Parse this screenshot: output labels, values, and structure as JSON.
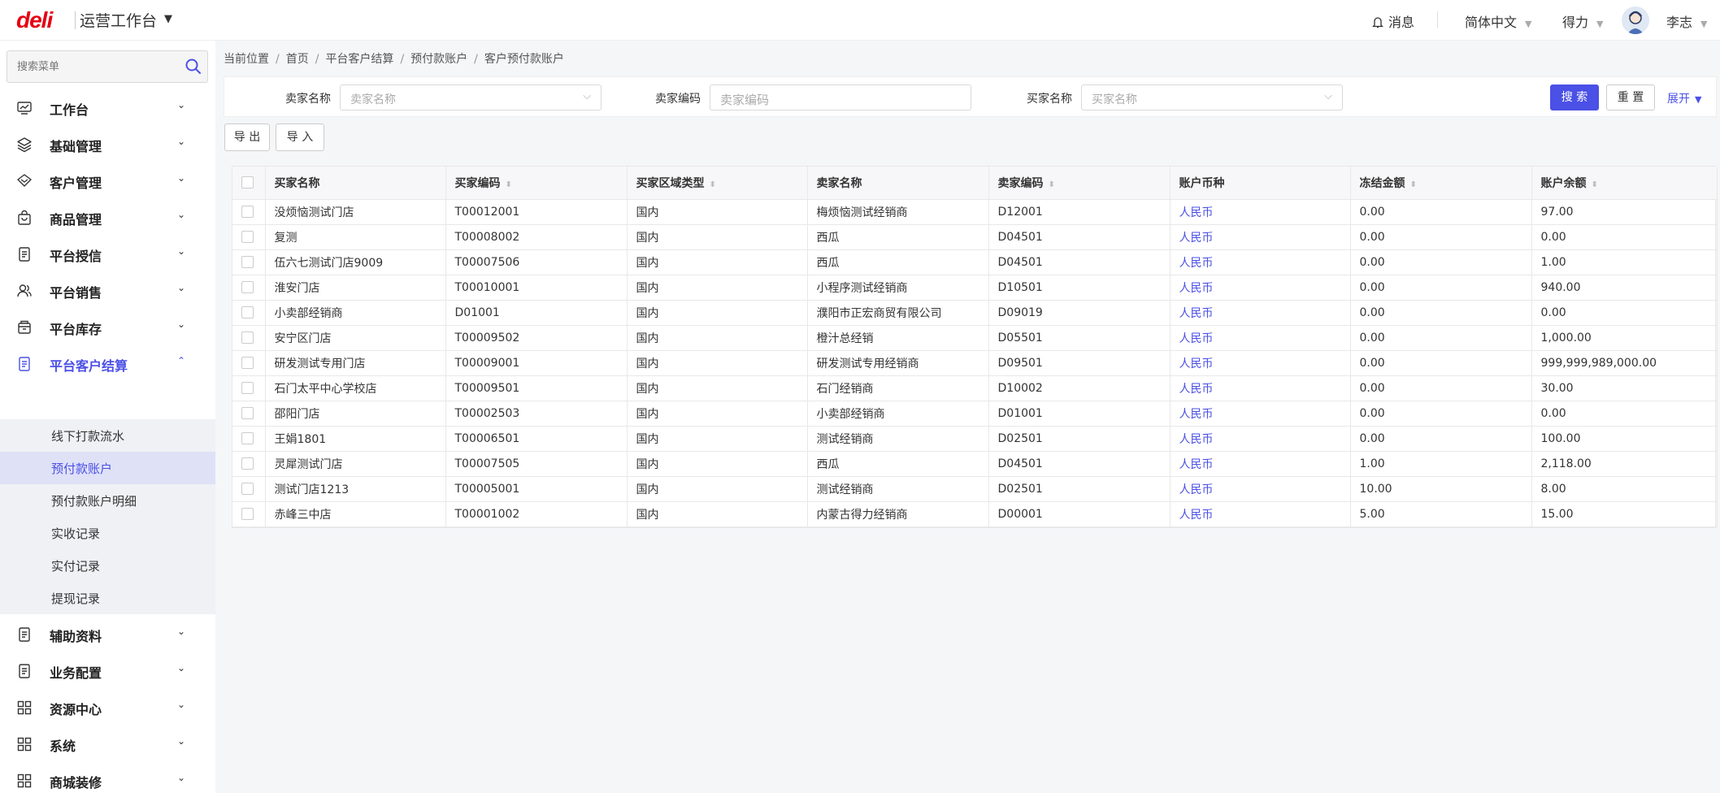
{
  "header": {
    "logo": "deli",
    "app_title": "运营工作台",
    "messages_label": "消息",
    "language": "简体中文",
    "brand": "得力",
    "user": "李志"
  },
  "sidebar": {
    "search_placeholder": "搜索菜单",
    "items": [
      {
        "label": "工作台",
        "icon": "dashboard-icon"
      },
      {
        "label": "基础管理",
        "icon": "layers-icon"
      },
      {
        "label": "客户管理",
        "icon": "diamond-icon"
      },
      {
        "label": "商品管理",
        "icon": "bag-icon"
      },
      {
        "label": "平台授信",
        "icon": "document-icon"
      },
      {
        "label": "平台销售",
        "icon": "users-icon"
      },
      {
        "label": "平台库存",
        "icon": "box-icon"
      },
      {
        "label": "平台客户结算",
        "icon": "document-icon"
      },
      {
        "label": "辅助资料",
        "icon": "document-icon"
      },
      {
        "label": "业务配置",
        "icon": "document-icon"
      },
      {
        "label": "资源中心",
        "icon": "grid-icon"
      },
      {
        "label": "系统",
        "icon": "grid-icon"
      },
      {
        "label": "商城装修",
        "icon": "grid-icon"
      }
    ],
    "submenu": [
      "线下打款流水",
      "预付款账户",
      "预付款账户明细",
      "实收记录",
      "实付记录",
      "提现记录"
    ]
  },
  "breadcrumb": {
    "prefix": "当前位置",
    "items": [
      "首页",
      "平台客户结算",
      "预付款账户",
      "客户预付款账户"
    ]
  },
  "filters": {
    "seller_name_label": "卖家名称",
    "seller_name_placeholder": "卖家名称",
    "seller_code_label": "卖家编码",
    "seller_code_placeholder": "卖家编码",
    "buyer_name_label": "买家名称",
    "buyer_name_placeholder": "买家名称",
    "search_btn": "搜 索",
    "reset_btn": "重 置",
    "expand_link": "展开"
  },
  "actions": {
    "export": "导 出",
    "import": "导 入"
  },
  "table": {
    "columns": [
      "买家名称",
      "买家编码",
      "买家区域类型",
      "卖家名称",
      "卖家编码",
      "账户币种",
      "冻结金额",
      "账户余额"
    ],
    "rows": [
      [
        "没烦恼测试门店",
        "T00012001",
        "国内",
        "梅烦恼测试经销商",
        "D12001",
        "人民币",
        "0.00",
        "97.00"
      ],
      [
        "复测",
        "T00008002",
        "国内",
        "西瓜",
        "D04501",
        "人民币",
        "0.00",
        "0.00"
      ],
      [
        "伍六七测试门店9009",
        "T00007506",
        "国内",
        "西瓜",
        "D04501",
        "人民币",
        "0.00",
        "1.00"
      ],
      [
        "淮安门店",
        "T00010001",
        "国内",
        "小程序测试经销商",
        "D10501",
        "人民币",
        "0.00",
        "940.00"
      ],
      [
        "小卖部经销商",
        "D01001",
        "国内",
        "濮阳市正宏商贸有限公司",
        "D09019",
        "人民币",
        "0.00",
        "0.00"
      ],
      [
        "安宁区门店",
        "T00009502",
        "国内",
        "橙汁总经销",
        "D05501",
        "人民币",
        "0.00",
        "1,000.00"
      ],
      [
        "研发测试专用门店",
        "T00009001",
        "国内",
        "研发测试专用经销商",
        "D09501",
        "人民币",
        "0.00",
        "999,999,989,000.00"
      ],
      [
        "石门太平中心学校店",
        "T00009501",
        "国内",
        "石门经销商",
        "D10002",
        "人民币",
        "0.00",
        "30.00"
      ],
      [
        "邵阳门店",
        "T00002503",
        "国内",
        "小卖部经销商",
        "D01001",
        "人民币",
        "0.00",
        "0.00"
      ],
      [
        "王娟1801",
        "T00006501",
        "国内",
        "测试经销商",
        "D02501",
        "人民币",
        "0.00",
        "100.00"
      ],
      [
        "灵犀测试门店",
        "T00007505",
        "国内",
        "西瓜",
        "D04501",
        "人民币",
        "1.00",
        "2,118.00"
      ],
      [
        "测试门店1213",
        "T00005001",
        "国内",
        "测试经销商",
        "D02501",
        "人民币",
        "10.00",
        "8.00"
      ],
      [
        "赤峰三中店",
        "T00001002",
        "国内",
        "内蒙古得力经销商",
        "D00001",
        "人民币",
        "5.00",
        "15.00"
      ]
    ]
  },
  "colors": {
    "accent": "#4b50e6",
    "brand": "#e60012"
  }
}
